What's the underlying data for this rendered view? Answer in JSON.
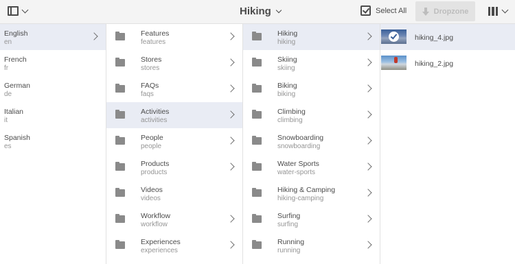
{
  "toolbar": {
    "title": "Hiking",
    "select_all": "Select All",
    "dropzone": "Dropzone",
    "icons": {
      "rail_toggle": "rail-toggle-icon",
      "select_all": "select-all-icon",
      "dropzone": "download-arrow-icon",
      "view": "column-view-icon"
    }
  },
  "languages": [
    {
      "label": "English",
      "name": "en",
      "selected": true
    },
    {
      "label": "French",
      "name": "fr"
    },
    {
      "label": "German",
      "name": "de"
    },
    {
      "label": "Italian",
      "name": "it"
    },
    {
      "label": "Spanish",
      "name": "es"
    }
  ],
  "sections": [
    {
      "label": "Features",
      "name": "features",
      "has_children": true
    },
    {
      "label": "Stores",
      "name": "stores",
      "has_children": true
    },
    {
      "label": "FAQs",
      "name": "faqs",
      "has_children": true
    },
    {
      "label": "Activities",
      "name": "activities",
      "has_children": true,
      "selected": true
    },
    {
      "label": "People",
      "name": "people",
      "has_children": true
    },
    {
      "label": "Products",
      "name": "products",
      "has_children": true
    },
    {
      "label": "Videos",
      "name": "videos",
      "has_children": false
    },
    {
      "label": "Workflow",
      "name": "workflow",
      "has_children": true
    },
    {
      "label": "Experiences",
      "name": "experiences",
      "has_children": true
    }
  ],
  "activities": [
    {
      "label": "Hiking",
      "name": "hiking",
      "selected": true
    },
    {
      "label": "Skiing",
      "name": "skiing"
    },
    {
      "label": "Biking",
      "name": "biking"
    },
    {
      "label": "Climbing",
      "name": "climbing"
    },
    {
      "label": "Snowboarding",
      "name": "snowboarding"
    },
    {
      "label": "Water Sports",
      "name": "water-sports"
    },
    {
      "label": "Hiking & Camping",
      "name": "hiking-camping"
    },
    {
      "label": "Surfing",
      "name": "surfing"
    },
    {
      "label": "Running",
      "name": "running"
    }
  ],
  "assets": [
    {
      "name": "hiking_4.jpg",
      "selected": true
    },
    {
      "name": "hiking_2.jpg"
    }
  ],
  "colors": {
    "toolbar_bg": "#f4f4f4",
    "selected_row": "#e9ecf4",
    "text": "#4b4b4b",
    "subtext": "#959595",
    "folder": "#8a8a8a"
  }
}
